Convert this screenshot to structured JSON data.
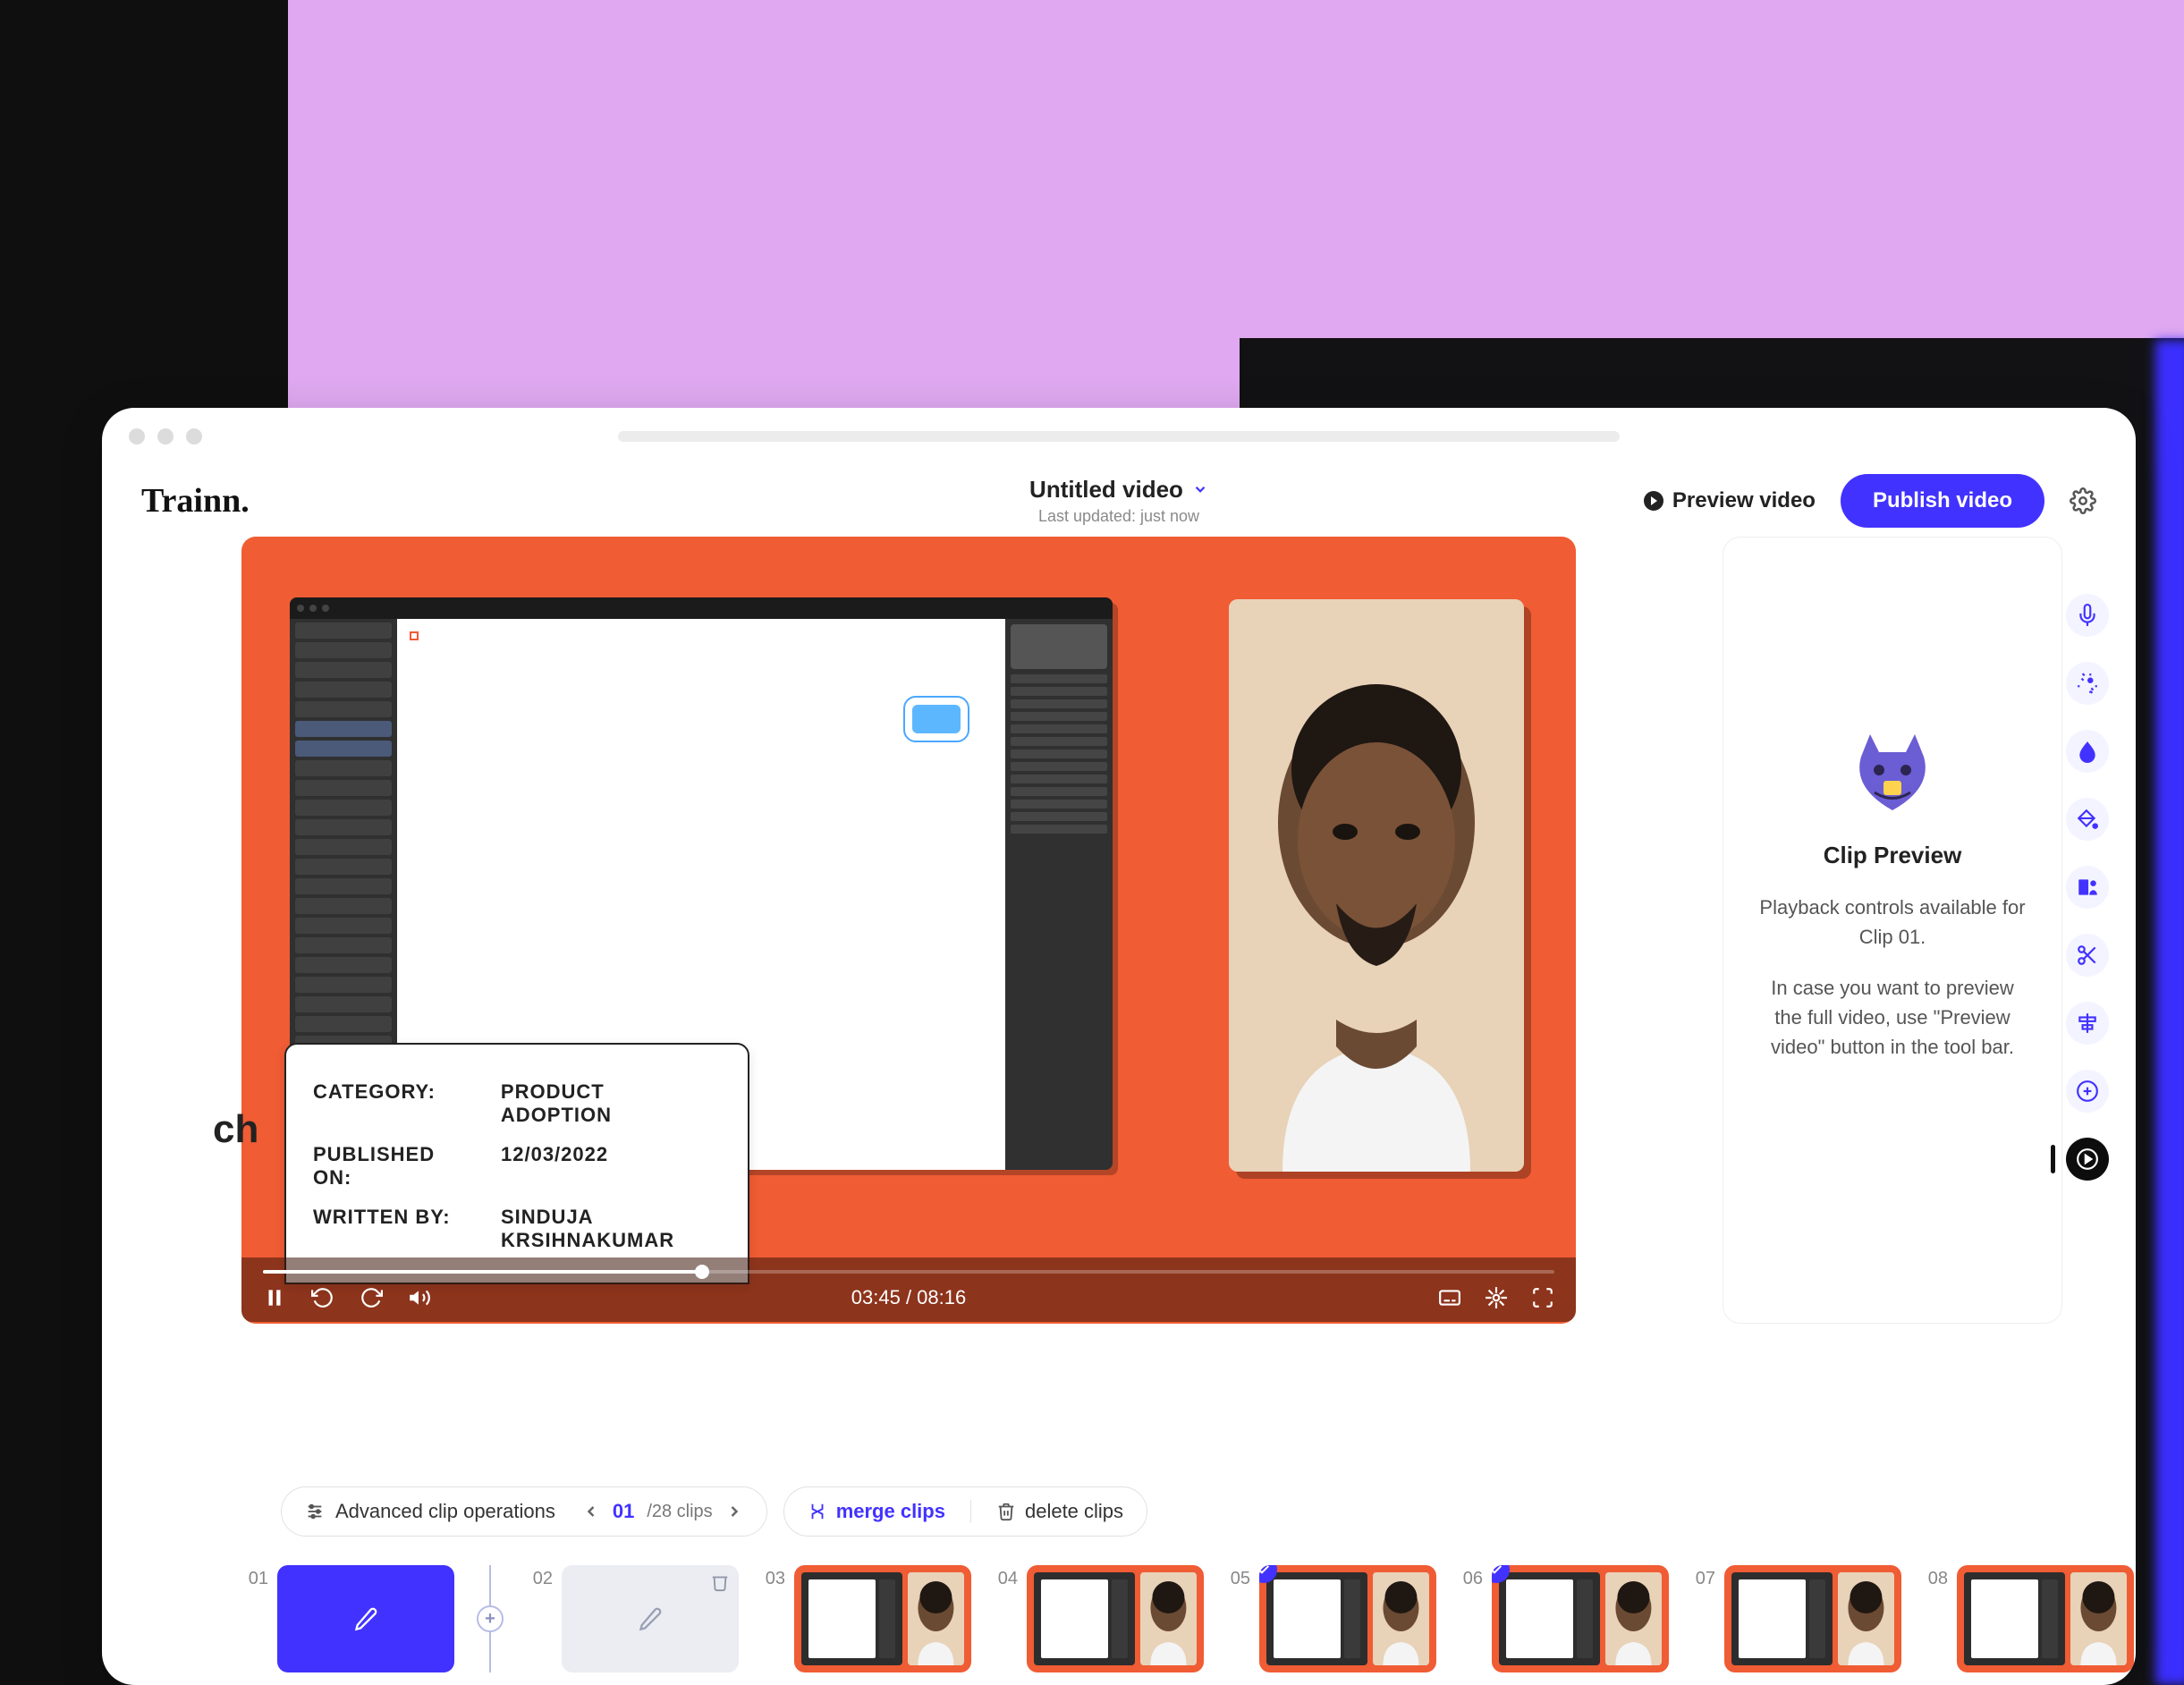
{
  "header": {
    "logo_text": "Trainn.",
    "title": "Untitled video",
    "last_updated": "Last updated: just now",
    "preview_label": "Preview video",
    "publish_label": "Publish video"
  },
  "video": {
    "doc": {
      "category_label": "CATEGORY:",
      "category_value": "PRODUCT ADOPTION",
      "published_label": "PUBLISHED ON:",
      "published_value": "12/03/2022",
      "written_label": "WRITTEN BY:",
      "written_value_1": "SINDUJA",
      "written_value_2": "KRSIHNAKUMAR",
      "title_fragment": "ch"
    },
    "controls": {
      "time": "03:45 / 08:16",
      "progress_percent": 34
    }
  },
  "clip_panel": {
    "title": "Clip Preview",
    "p1": "Playback controls available for Clip 01.",
    "p2": "In case you want to preview the full video, use \"Preview video\" button in the tool bar."
  },
  "clip_toolbar": {
    "advanced_label": "Advanced clip operations",
    "current_clip": "01",
    "total_label": "/28 clips",
    "merge_label": "merge clips",
    "delete_label": "delete clips"
  },
  "thumbnails": [
    {
      "num": "01"
    },
    {
      "num": "02"
    },
    {
      "num": "03"
    },
    {
      "num": "04"
    },
    {
      "num": "05"
    },
    {
      "num": "06"
    },
    {
      "num": "07"
    },
    {
      "num": "08"
    }
  ],
  "colors": {
    "accent": "#4232ff",
    "orange": "#f05c34",
    "lavender": "#dfa8f0"
  }
}
